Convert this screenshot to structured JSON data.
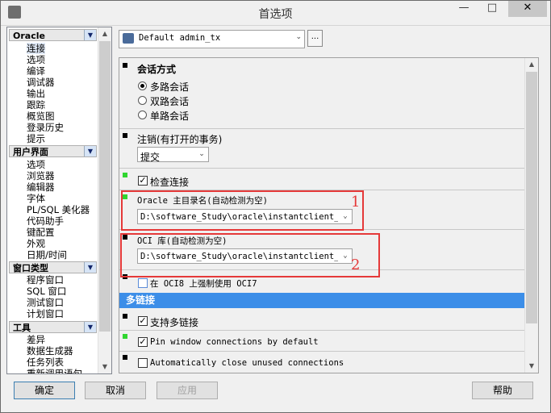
{
  "window": {
    "title": "首选项",
    "minimize": "—",
    "maximize": "□",
    "close": "✕"
  },
  "nav": {
    "groups": [
      {
        "label": "Oracle",
        "items": [
          "连接",
          "选项",
          "编译",
          "调试器",
          "输出",
          "跟踪",
          "概览图",
          "登录历史",
          "提示"
        ]
      },
      {
        "label": "用户界面",
        "items": [
          "选项",
          "浏览器",
          "编辑器",
          "字体",
          "PL/SQL 美化器",
          "代码助手",
          "键配置",
          "外观",
          "日期/时间"
        ]
      },
      {
        "label": "窗口类型",
        "items": [
          "程序窗口",
          "SQL 窗口",
          "测试窗口",
          "计划窗口"
        ]
      },
      {
        "label": "工具",
        "items": [
          "差异",
          "数据生成器",
          "任务列表",
          "重新调用语句"
        ]
      }
    ],
    "selected": "连接"
  },
  "user_settings": {
    "value": "Default admin_tx",
    "more": "..."
  },
  "panel": {
    "session": {
      "title": "会话方式",
      "options": [
        "多路会话",
        "双路会话",
        "单路会话"
      ],
      "selected": 0
    },
    "logoff": {
      "title": "注销(有打开的事务)",
      "value": "提交"
    },
    "check_connection": {
      "label": "检查连接",
      "checked": true
    },
    "oracle_home": {
      "label": "Oracle 主目录名(自动检测为空)",
      "value": "D:\\software_Study\\oracle\\instantclient_11"
    },
    "oci_library": {
      "label": "OCI 库(自动检测为空)",
      "value": "D:\\software_Study\\oracle\\instantclient_11"
    },
    "force_oci7": {
      "label": "在 OCI8 上强制使用 OCI7",
      "checked": false
    },
    "multi_connect": {
      "title": "多链接",
      "support": {
        "label": "支持多链接",
        "checked": true
      },
      "pin_window": {
        "label": "Pin window connections by default",
        "checked": true
      },
      "auto_close": {
        "label": "Automatically close unused connections",
        "checked": false
      }
    }
  },
  "annotations": {
    "label1": "1",
    "label2": "2",
    "color": "#e53939"
  },
  "buttons": {
    "ok": "确定",
    "cancel": "取消",
    "apply": "应用",
    "help": "帮助"
  },
  "colors": {
    "section_bar": "#3c8ee8",
    "marker_green": "#2fd62f"
  }
}
